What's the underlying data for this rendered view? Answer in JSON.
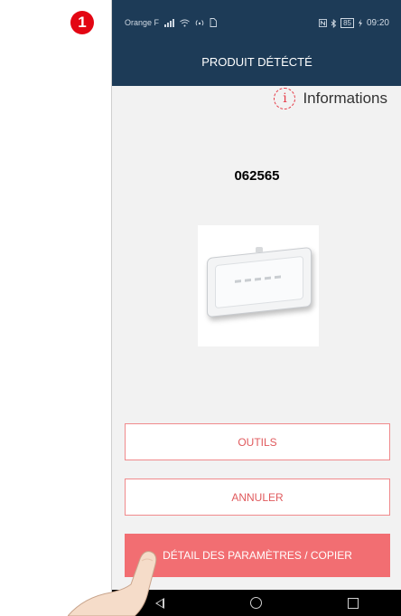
{
  "step_badge": "1",
  "status_bar": {
    "carrier": "Orange F",
    "battery": "85",
    "time": "09:20",
    "left_icons": [
      "signal-icon",
      "wifi-icon",
      "hotspot-icon",
      "sim-icon"
    ],
    "right_icons": [
      "nfc-icon",
      "bluetooth-icon",
      "battery-icon",
      "charging-icon"
    ]
  },
  "header": {
    "title": "PRODUIT DÉTÉCTÉ"
  },
  "info": {
    "icon": "info-icon",
    "label": "Informations"
  },
  "product": {
    "code": "062565",
    "image": "emergency-light-image"
  },
  "buttons": {
    "tools": "OUTILS",
    "cancel": "ANNULER",
    "details": "DÉTAIL DES PARAMÈTRES / COPIER"
  },
  "nav": {
    "icons": [
      "back-icon",
      "home-icon",
      "recent-apps-icon"
    ]
  },
  "colors": {
    "header_bg": "#1d3b57",
    "accent": "#f26e72",
    "badge": "#e30613"
  }
}
